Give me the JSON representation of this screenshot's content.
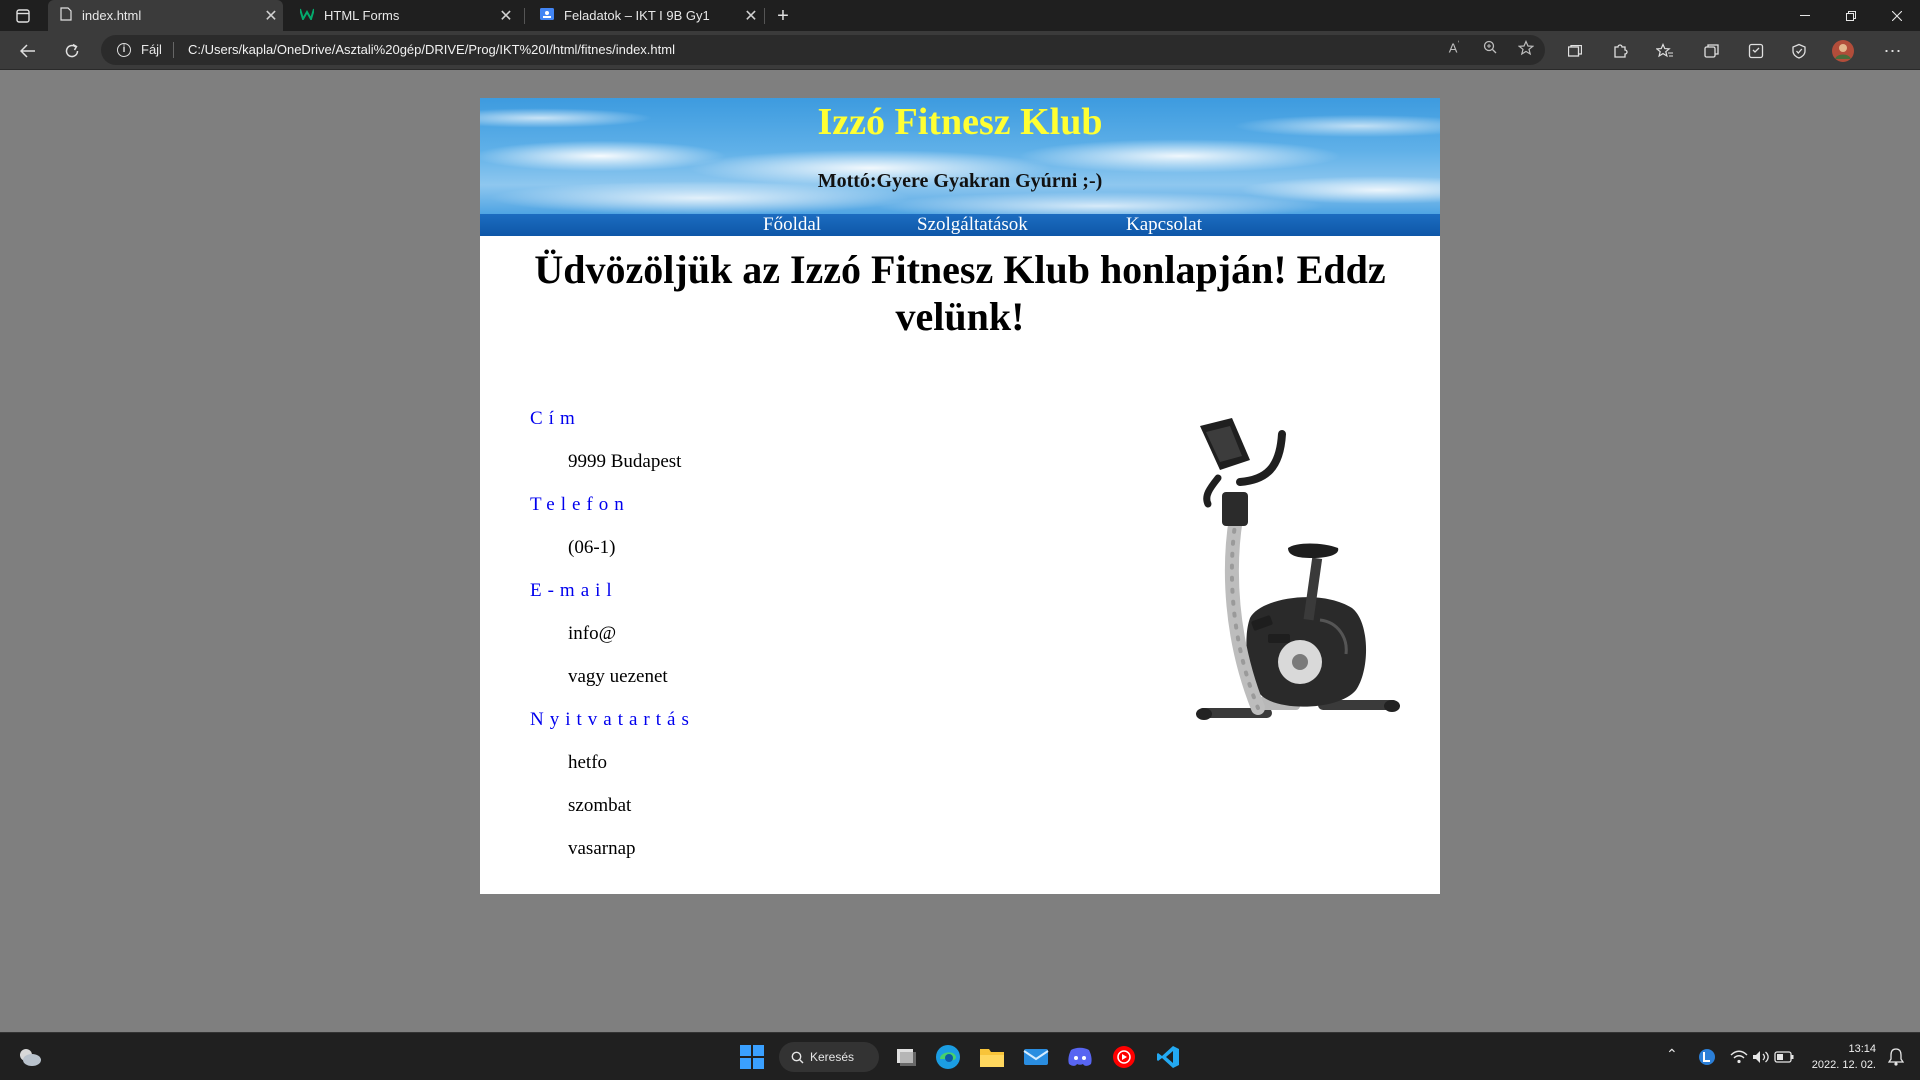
{
  "tabs": [
    {
      "title": "index.html",
      "close": "✕"
    },
    {
      "title": "HTML Forms",
      "close": "✕"
    },
    {
      "title": "Feladatok – IKT I 9B Gy1",
      "close": "✕"
    }
  ],
  "address_bar": {
    "scheme_label": "Fájl",
    "url": "C:/Users/kapla/OneDrive/Asztali%20gép/DRIVE/Prog/IKT%20I/html/fitnes/index.html"
  },
  "site": {
    "title": "Izzó Fitnesz Klub",
    "motto": "Mottó:Gyere Gyakran Gyúrni ;-)",
    "nav": [
      "Főoldal",
      "Szolgáltatások",
      "Kapcsolat"
    ],
    "welcome": "Üdvözöljük az Izzó Fitnesz Klub honlapján! Eddz velünk!",
    "contact": {
      "address_label": "Cím",
      "address": "9999 Budapest",
      "phone_label": "Telefon",
      "phone": "(06-1)",
      "email_label": "E-mail",
      "email": "info@",
      "email_alt": "vagy uezenet",
      "hours_label": "Nyitvatartás",
      "hours": [
        "hetfo",
        "szombat",
        "vasarnap"
      ]
    }
  },
  "taskbar": {
    "search_label": "Keresés",
    "time": "13:14",
    "date": "2022. 12. 02."
  },
  "colors": {
    "title_yellow": "#ffff33",
    "link_blue": "#0000ee",
    "nav_blue": "#0e57a8",
    "browser_dark": "#1f1f1f",
    "page_bg_gray": "#7f7f7f"
  }
}
